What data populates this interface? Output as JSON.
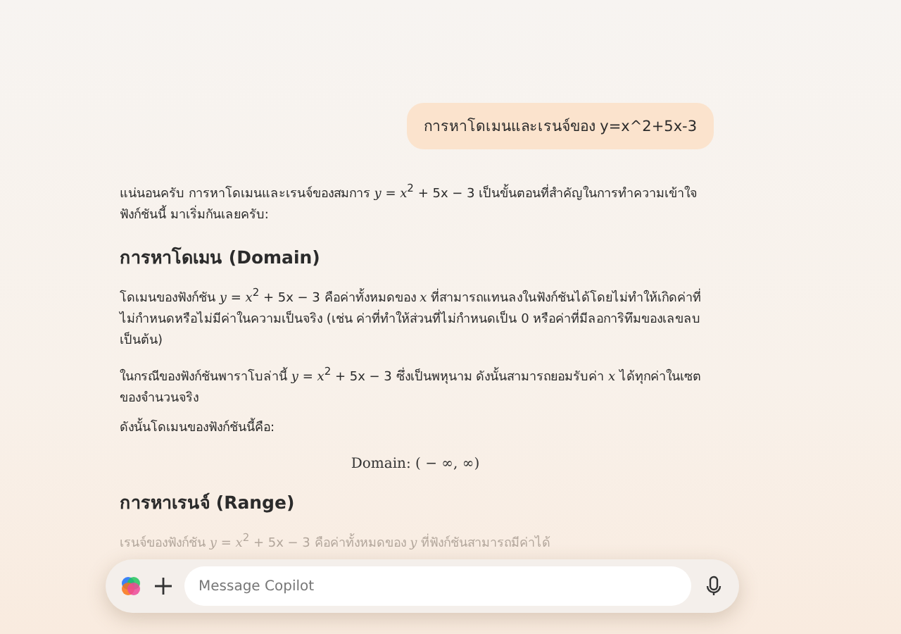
{
  "user_message": {
    "text": "การหาโดเมนและเรนจ์ของ y=x^2+5x-3"
  },
  "response": [
    {
      "kind": "paragraph",
      "text": "แน่นอนครับ การหาโดเมนและเรนจ์ของสมการ *y* = *x*$^{2}$ + 5x − 3 เป็นขั้นตอนที่สำคัญในการทำความเข้าใจฟังก์ชันนี้ มาเริ่มกันเลยครับ:"
    },
    {
      "kind": "heading",
      "text": "การหาโดเมน (Domain)"
    },
    {
      "kind": "paragraph",
      "text": "โดเมนของฟังก์ชัน *y* = *x*$^{2}$ + 5x − 3 คือค่าทั้งหมดของ *x* ที่สามารถแทนลงในฟังก์ชันได้โดยไม่ทำให้เกิดค่าที่ไม่กำหนดหรือไม่มีค่าในความเป็นจริง (เช่น ค่าที่ทำให้ส่วนที่ไม่กำหนดเป็น 0 หรือค่าที่มีลอการิทึมของเลขลบ เป็นต้น)"
    },
    {
      "kind": "paragraph",
      "text": "ในกรณีของฟังก์ชันพาราโบล่านี้ *y* = *x*$^{2}$ + 5x − 3 ซึ่งเป็นพหุนาม ดังนั้นสามารถยอมรับค่า *x* ได้ทุกค่าในเซตของจำนวนจริง"
    },
    {
      "kind": "paragraph",
      "text": "ดังนั้นโดเมนของฟังก์ชันนี้คือ:"
    },
    {
      "kind": "formula",
      "text": "Domain: ( − ∞, ∞)"
    },
    {
      "kind": "heading",
      "text": "การหาเรนจ์ (Range)"
    },
    {
      "kind": "faded",
      "text": "เรนจ์ของฟังก์ชัน *y* = *x*$^{2}$ + 5x − 3 คือค่าทั้งหมดของ *y* ที่ฟังก์ชันสามารถมีค่าได้"
    }
  ],
  "composer": {
    "placeholder": "Message Copilot"
  }
}
